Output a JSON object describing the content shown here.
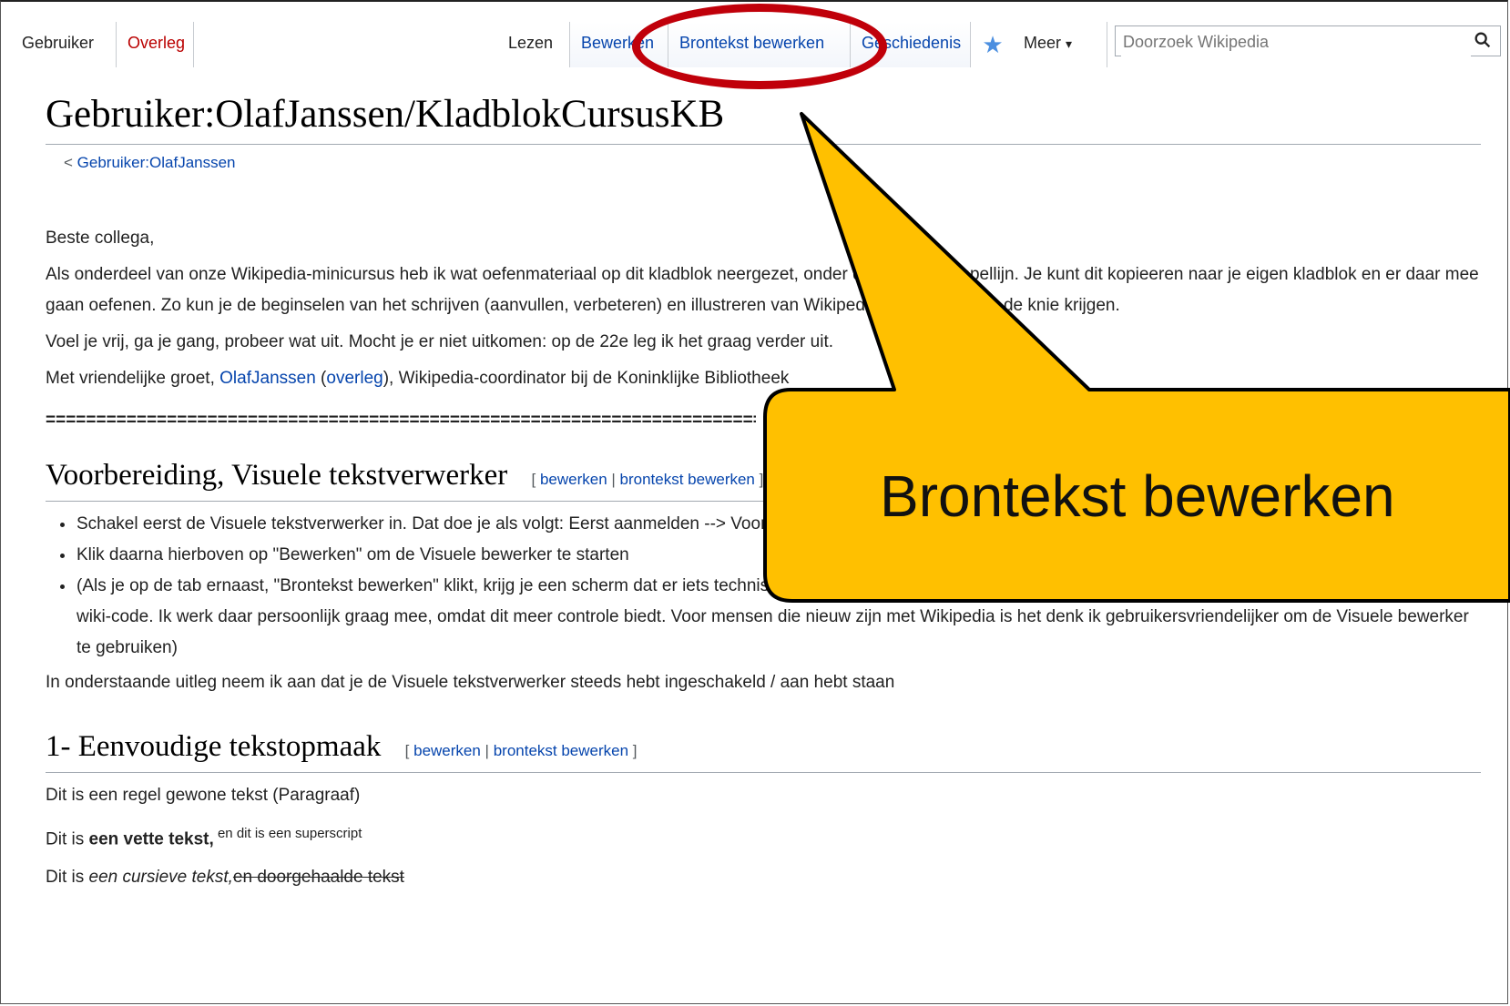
{
  "tabs": {
    "gebruiker": "Gebruiker",
    "overleg": "Overleg",
    "lezen": "Lezen",
    "bewerken": "Bewerken",
    "brontekst": "Brontekst bewerken",
    "geschiedenis": "Geschiedenis",
    "meer": "Meer"
  },
  "search": {
    "placeholder": "Doorzoek Wikipedia"
  },
  "page": {
    "title": "Gebruiker:OlafJanssen/KladblokCursusKB",
    "breadcrumb_prefix": "< ",
    "breadcrumb_link": "Gebruiker:OlafJanssen",
    "greeting": "Beste collega,",
    "intro": "Als onderdeel van onze Wikipedia-minicursus heb ik wat oefenmateriaal op dit kladblok neergezet, onder de dubbele stippellijn. Je kunt dit kopieeren naar je eigen kladblok en er daar mee gaan oefenen. Zo kun je de beginselen van het schrijven (aanvullen, verbeteren) en illustreren van Wikipedia-artikelen onder de knie krijgen.",
    "free": "Voel je vrij, ga je gang, probeer wat uit. Mocht je er niet uitkomen: op de 22e leg ik het graag verder uit.",
    "regards_prefix": "Met vriendelijke groet, ",
    "regards_user": "OlafJanssen",
    "regards_open": " (",
    "regards_talk": "overleg",
    "regards_suffix": "), Wikipedia-coordinator bij de Koninklijke Bibliotheek",
    "separator": "==========================================================================",
    "section1_title": "Voorbereiding, Visuele tekstverwerker",
    "edit_open": "[ ",
    "edit_label": "bewerken",
    "edit_pipe": " | ",
    "edit_source": "brontekst bewerken",
    "edit_close": " ]",
    "bullets": [
      "Schakel eerst de Visuele tekstverwerker in. Dat doe je als volgt: Eerst aanmelden --> Voorkeuren --> Bewerken --> Visuele tekstverwerker aanvinken --> Opslaan\"",
      "Klik daarna hierboven op \"Bewerken\" om de Visuele bewerker te starten",
      "(Als je op de tab ernaast, \"Brontekst bewerken\" klikt, krijg je een scherm dat er iets technischer uitziet, maar waar je ook prima mee kunt bewerken, je werkt dan rechtstreeks in de wiki-code. Ik werk daar persoonlijk graag mee, omdat dit meer controle biedt. Voor mensen die nieuw zijn met Wikipedia is het denk ik gebruikersvriendelijker om de Visuele bewerker te gebruiken)"
    ],
    "after_bullets": "In onderstaande uitleg neem ik aan dat je de Visuele tekstverwerker steeds hebt ingeschakeld / aan hebt staan",
    "section2_title": "1- Eenvoudige tekstopmaak",
    "line1": "Dit is een regel gewone tekst (Paragraaf)",
    "line2_prefix": "Dit is ",
    "line2_bold": "een vette tekst,",
    "line2_sup": " en dit is een superscript",
    "line3_prefix": "Dit is ",
    "line3_italic": "een cursieve tekst,",
    "line3_strike": "en doorgehaalde tekst"
  },
  "callout": {
    "label": "Brontekst bewerken",
    "fill_color": "#FFC000",
    "ellipse_color": "#C0000A"
  }
}
